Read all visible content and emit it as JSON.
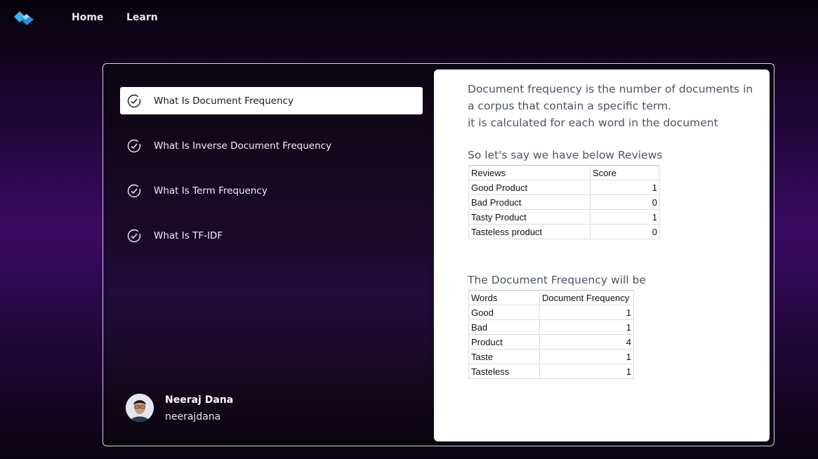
{
  "nav": {
    "links": [
      "Home",
      "Learn"
    ]
  },
  "sidebar": {
    "items": [
      {
        "label": "What Is Document Frequency",
        "active": true
      },
      {
        "label": "What Is Inverse Document Frequency",
        "active": false
      },
      {
        "label": "What Is Term Frequency",
        "active": false
      },
      {
        "label": "What Is TF-IDF",
        "active": false
      }
    ],
    "profile": {
      "name": "Neeraj Dana",
      "handle": "neerajdana"
    }
  },
  "content": {
    "description": [
      "Document frequency is the number of documents in",
      "a corpus that contain a specific term.",
      "it is calculated for each word in the document"
    ],
    "reviews_title": "So let's say we have below Reviews",
    "reviews_table": {
      "headers": [
        "Reviews",
        "Score"
      ],
      "rows": [
        [
          "Good Product",
          "1"
        ],
        [
          "Bad Product",
          "0"
        ],
        [
          "Tasty Product",
          "1"
        ],
        [
          "Tasteless product",
          "0"
        ]
      ]
    },
    "df_title": "The Document Frequency will be",
    "df_table": {
      "headers": [
        "Words",
        "Document Frequency"
      ],
      "rows": [
        [
          "Good",
          "1"
        ],
        [
          "Bad",
          "1"
        ],
        [
          "Product",
          "4"
        ],
        [
          "Taste",
          "1"
        ],
        [
          "Tasteless",
          "1"
        ]
      ]
    }
  },
  "colors": {
    "accent": "#2ea8e6",
    "active_item_bg": "#ffffff",
    "panel_bg": "#ffffff",
    "text_muted": "#4b5563"
  },
  "icons": {
    "logo": "logo-icon",
    "check": "check-circle-icon"
  }
}
